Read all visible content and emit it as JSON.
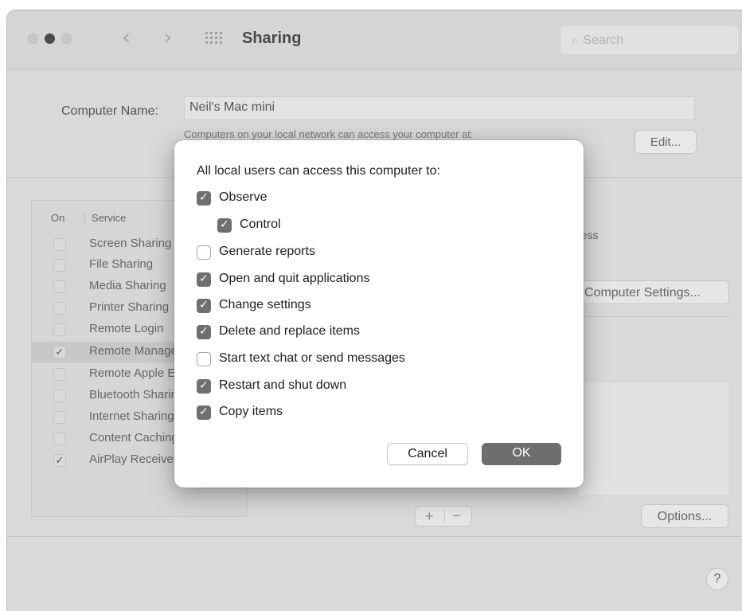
{
  "window": {
    "title": "Sharing",
    "back_icon": "chevron-left",
    "forward_icon": "chevron-right",
    "show_all_icon": "grid-icon"
  },
  "search": {
    "placeholder": "Search"
  },
  "computer_name": {
    "label": "Computer Name:",
    "value": "Neil's Mac mini",
    "subtitle": "Computers on your local network can access your computer at:",
    "edit_label": "Edit..."
  },
  "services": {
    "header_on": "On",
    "header_service": "Service",
    "items": [
      {
        "label": "Screen Sharing",
        "checked": false,
        "selected": false
      },
      {
        "label": "File Sharing",
        "checked": false,
        "selected": false
      },
      {
        "label": "Media Sharing",
        "checked": false,
        "selected": false
      },
      {
        "label": "Printer Sharing",
        "checked": false,
        "selected": false
      },
      {
        "label": "Remote Login",
        "checked": false,
        "selected": false
      },
      {
        "label": "Remote Management",
        "checked": true,
        "selected": true
      },
      {
        "label": "Remote Apple Events",
        "checked": false,
        "selected": false
      },
      {
        "label": "Bluetooth Sharing",
        "checked": false,
        "selected": false
      },
      {
        "label": "Internet Sharing",
        "checked": false,
        "selected": false
      },
      {
        "label": "Content Caching",
        "checked": false,
        "selected": false
      },
      {
        "label": "AirPlay Receiver",
        "checked": true,
        "selected": false
      }
    ]
  },
  "right_panel": {
    "address_fragment": "ress",
    "computer_settings_label": "Computer Settings...",
    "options_label": "Options...",
    "add_label": "+",
    "remove_label": "−"
  },
  "dialog": {
    "title": "All local users can access this computer to:",
    "options": [
      {
        "label": "Observe",
        "checked": true,
        "indent": false
      },
      {
        "label": "Control",
        "checked": true,
        "indent": true
      },
      {
        "label": "Generate reports",
        "checked": false,
        "indent": false
      },
      {
        "label": "Open and quit applications",
        "checked": true,
        "indent": false
      },
      {
        "label": "Change settings",
        "checked": true,
        "indent": false
      },
      {
        "label": "Delete and replace items",
        "checked": true,
        "indent": false
      },
      {
        "label": "Start text chat or send messages",
        "checked": false,
        "indent": false
      },
      {
        "label": "Restart and shut down",
        "checked": true,
        "indent": false
      },
      {
        "label": "Copy items",
        "checked": true,
        "indent": false
      }
    ],
    "cancel_label": "Cancel",
    "ok_label": "OK"
  },
  "help_label": "?",
  "colors": {
    "window_bg": "#d9d9d9",
    "dialog_bg": "#ffffff",
    "checkbox_checked": "#6f6f6f",
    "ok_button": "#6e6e6e"
  }
}
